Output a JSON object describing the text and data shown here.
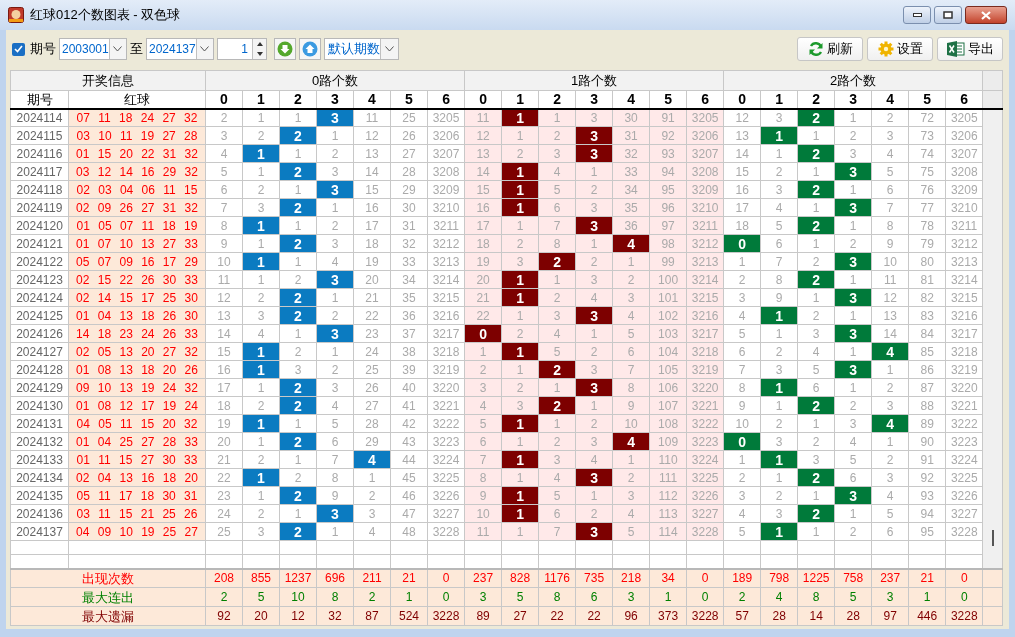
{
  "window": {
    "title": "红球012个数图表 - 双色球"
  },
  "toolbar": {
    "period_filter": {
      "label": "期号",
      "checked": true
    },
    "from": "2003001",
    "to_label": "至",
    "to": "2024137",
    "step": "1",
    "preset": "默认期数",
    "buttons": [
      {
        "label": "刷新",
        "kind": "refresh"
      },
      {
        "label": "设置",
        "kind": "settings"
      },
      {
        "label": "导出",
        "kind": "export"
      }
    ]
  },
  "table": {
    "info_header": "开奖信息",
    "columns": [
      "期号",
      "红球"
    ],
    "groups": [
      {
        "title": "0路个数",
        "color": "#0b7bc1",
        "columns": [
          "0",
          "1",
          "2",
          "3",
          "4",
          "5",
          "6"
        ]
      },
      {
        "title": "1路个数",
        "color": "#7d0000",
        "columns": [
          "0",
          "1",
          "2",
          "3",
          "4",
          "5",
          "6"
        ]
      },
      {
        "title": "2路个数",
        "color": "#007a3a",
        "columns": [
          "0",
          "1",
          "2",
          "3",
          "4",
          "5",
          "6"
        ]
      }
    ],
    "rows": [
      {
        "period": "2024114",
        "balls": "07 11 18 24 27 32",
        "groups": [
          {
            "cells": [
              "2",
              "1",
              "1",
              "3",
              "11",
              "25",
              "3205"
            ],
            "hit": [
              false,
              false,
              false,
              true,
              false,
              false,
              false
            ]
          },
          {
            "cells": [
              "11",
              "1",
              "1",
              "3",
              "30",
              "91",
              "3205"
            ],
            "hit": [
              false,
              true,
              false,
              false,
              false,
              false,
              false
            ]
          },
          {
            "cells": [
              "12",
              "3",
              "2",
              "1",
              "2",
              "72",
              "3205"
            ],
            "hit": [
              false,
              false,
              true,
              false,
              false,
              false,
              false
            ]
          }
        ]
      },
      {
        "period": "2024115",
        "balls": "03 10 11 19 27 28",
        "groups": [
          {
            "cells": [
              "3",
              "2",
              "2",
              "1",
              "12",
              "26",
              "3206"
            ],
            "hit": [
              false,
              false,
              true,
              false,
              false,
              false,
              false
            ]
          },
          {
            "cells": [
              "12",
              "1",
              "2",
              "3",
              "31",
              "92",
              "3206"
            ],
            "hit": [
              false,
              false,
              false,
              true,
              false,
              false,
              false
            ]
          },
          {
            "cells": [
              "13",
              "1",
              "1",
              "2",
              "3",
              "73",
              "3206"
            ],
            "hit": [
              false,
              true,
              false,
              false,
              false,
              false,
              false
            ]
          }
        ]
      },
      {
        "period": "2024116",
        "balls": "01 15 20 22 31 32",
        "groups": [
          {
            "cells": [
              "4",
              "1",
              "1",
              "2",
              "13",
              "27",
              "3207"
            ],
            "hit": [
              false,
              true,
              false,
              false,
              false,
              false,
              false
            ]
          },
          {
            "cells": [
              "13",
              "2",
              "3",
              "3",
              "32",
              "93",
              "3207"
            ],
            "hit": [
              false,
              false,
              false,
              true,
              false,
              false,
              false
            ]
          },
          {
            "cells": [
              "14",
              "1",
              "2",
              "3",
              "4",
              "74",
              "3207"
            ],
            "hit": [
              false,
              false,
              true,
              false,
              false,
              false,
              false
            ]
          }
        ]
      },
      {
        "period": "2024117",
        "balls": "03 12 14 16 29 32",
        "groups": [
          {
            "cells": [
              "5",
              "1",
              "2",
              "3",
              "14",
              "28",
              "3208"
            ],
            "hit": [
              false,
              false,
              true,
              false,
              false,
              false,
              false
            ]
          },
          {
            "cells": [
              "14",
              "1",
              "4",
              "1",
              "33",
              "94",
              "3208"
            ],
            "hit": [
              false,
              true,
              false,
              false,
              false,
              false,
              false
            ]
          },
          {
            "cells": [
              "15",
              "2",
              "1",
              "3",
              "5",
              "75",
              "3208"
            ],
            "hit": [
              false,
              false,
              false,
              true,
              false,
              false,
              false
            ]
          }
        ]
      },
      {
        "period": "2024118",
        "balls": "02 03 04 06 11 15",
        "groups": [
          {
            "cells": [
              "6",
              "2",
              "1",
              "3",
              "15",
              "29",
              "3209"
            ],
            "hit": [
              false,
              false,
              false,
              true,
              false,
              false,
              false
            ]
          },
          {
            "cells": [
              "15",
              "1",
              "5",
              "2",
              "34",
              "95",
              "3209"
            ],
            "hit": [
              false,
              true,
              false,
              false,
              false,
              false,
              false
            ]
          },
          {
            "cells": [
              "16",
              "3",
              "2",
              "1",
              "6",
              "76",
              "3209"
            ],
            "hit": [
              false,
              false,
              true,
              false,
              false,
              false,
              false
            ]
          }
        ]
      },
      {
        "period": "2024119",
        "balls": "02 09 26 27 31 32",
        "groups": [
          {
            "cells": [
              "7",
              "3",
              "2",
              "1",
              "16",
              "30",
              "3210"
            ],
            "hit": [
              false,
              false,
              true,
              false,
              false,
              false,
              false
            ]
          },
          {
            "cells": [
              "16",
              "1",
              "6",
              "3",
              "35",
              "96",
              "3210"
            ],
            "hit": [
              false,
              true,
              false,
              false,
              false,
              false,
              false
            ]
          },
          {
            "cells": [
              "17",
              "4",
              "1",
              "3",
              "7",
              "77",
              "3210"
            ],
            "hit": [
              false,
              false,
              false,
              true,
              false,
              false,
              false
            ]
          }
        ]
      },
      {
        "period": "2024120",
        "balls": "01 05 07 11 18 19",
        "groups": [
          {
            "cells": [
              "8",
              "1",
              "1",
              "2",
              "17",
              "31",
              "3211"
            ],
            "hit": [
              false,
              true,
              false,
              false,
              false,
              false,
              false
            ]
          },
          {
            "cells": [
              "17",
              "1",
              "7",
              "3",
              "36",
              "97",
              "3211"
            ],
            "hit": [
              false,
              false,
              false,
              true,
              false,
              false,
              false
            ]
          },
          {
            "cells": [
              "18",
              "5",
              "2",
              "1",
              "8",
              "78",
              "3211"
            ],
            "hit": [
              false,
              false,
              true,
              false,
              false,
              false,
              false
            ]
          }
        ]
      },
      {
        "period": "2024121",
        "balls": "01 07 10 13 27 33",
        "groups": [
          {
            "cells": [
              "9",
              "1",
              "2",
              "3",
              "18",
              "32",
              "3212"
            ],
            "hit": [
              false,
              false,
              true,
              false,
              false,
              false,
              false
            ]
          },
          {
            "cells": [
              "18",
              "2",
              "8",
              "1",
              "4",
              "98",
              "3212"
            ],
            "hit": [
              false,
              false,
              false,
              false,
              true,
              false,
              false
            ]
          },
          {
            "cells": [
              "0",
              "6",
              "1",
              "2",
              "9",
              "79",
              "3212"
            ],
            "hit": [
              true,
              false,
              false,
              false,
              false,
              false,
              false
            ]
          }
        ]
      },
      {
        "period": "2024122",
        "balls": "05 07 09 16 17 29",
        "groups": [
          {
            "cells": [
              "10",
              "1",
              "1",
              "4",
              "19",
              "33",
              "3213"
            ],
            "hit": [
              false,
              true,
              false,
              false,
              false,
              false,
              false
            ]
          },
          {
            "cells": [
              "19",
              "3",
              "2",
              "2",
              "1",
              "99",
              "3213"
            ],
            "hit": [
              false,
              false,
              true,
              false,
              false,
              false,
              false
            ]
          },
          {
            "cells": [
              "1",
              "7",
              "2",
              "3",
              "10",
              "80",
              "3213"
            ],
            "hit": [
              false,
              false,
              false,
              true,
              false,
              false,
              false
            ]
          }
        ]
      },
      {
        "period": "2024123",
        "balls": "02 15 22 26 30 33",
        "groups": [
          {
            "cells": [
              "11",
              "1",
              "2",
              "3",
              "20",
              "34",
              "3214"
            ],
            "hit": [
              false,
              false,
              false,
              true,
              false,
              false,
              false
            ]
          },
          {
            "cells": [
              "20",
              "1",
              "1",
              "3",
              "2",
              "100",
              "3214"
            ],
            "hit": [
              false,
              true,
              false,
              false,
              false,
              false,
              false
            ]
          },
          {
            "cells": [
              "2",
              "8",
              "2",
              "1",
              "11",
              "81",
              "3214"
            ],
            "hit": [
              false,
              false,
              true,
              false,
              false,
              false,
              false
            ]
          }
        ]
      },
      {
        "period": "2024124",
        "balls": "02 14 15 17 25 30",
        "groups": [
          {
            "cells": [
              "12",
              "2",
              "2",
              "1",
              "21",
              "35",
              "3215"
            ],
            "hit": [
              false,
              false,
              true,
              false,
              false,
              false,
              false
            ]
          },
          {
            "cells": [
              "21",
              "1",
              "2",
              "4",
              "3",
              "101",
              "3215"
            ],
            "hit": [
              false,
              true,
              false,
              false,
              false,
              false,
              false
            ]
          },
          {
            "cells": [
              "3",
              "9",
              "1",
              "3",
              "12",
              "82",
              "3215"
            ],
            "hit": [
              false,
              false,
              false,
              true,
              false,
              false,
              false
            ]
          }
        ]
      },
      {
        "period": "2024125",
        "balls": "01 04 13 18 26 30",
        "groups": [
          {
            "cells": [
              "13",
              "3",
              "2",
              "2",
              "22",
              "36",
              "3216"
            ],
            "hit": [
              false,
              false,
              true,
              false,
              false,
              false,
              false
            ]
          },
          {
            "cells": [
              "22",
              "1",
              "3",
              "3",
              "4",
              "102",
              "3216"
            ],
            "hit": [
              false,
              false,
              false,
              true,
              false,
              false,
              false
            ]
          },
          {
            "cells": [
              "4",
              "1",
              "2",
              "1",
              "13",
              "83",
              "3216"
            ],
            "hit": [
              false,
              true,
              false,
              false,
              false,
              false,
              false
            ]
          }
        ]
      },
      {
        "period": "2024126",
        "balls": "14 18 23 24 26 33",
        "groups": [
          {
            "cells": [
              "14",
              "4",
              "1",
              "3",
              "23",
              "37",
              "3217"
            ],
            "hit": [
              false,
              false,
              false,
              true,
              false,
              false,
              false
            ]
          },
          {
            "cells": [
              "0",
              "2",
              "4",
              "1",
              "5",
              "103",
              "3217"
            ],
            "hit": [
              true,
              false,
              false,
              false,
              false,
              false,
              false
            ]
          },
          {
            "cells": [
              "5",
              "1",
              "3",
              "3",
              "14",
              "84",
              "3217"
            ],
            "hit": [
              false,
              false,
              false,
              true,
              false,
              false,
              false
            ]
          }
        ]
      },
      {
        "period": "2024127",
        "balls": "02 05 13 20 27 32",
        "groups": [
          {
            "cells": [
              "15",
              "1",
              "2",
              "1",
              "24",
              "38",
              "3218"
            ],
            "hit": [
              false,
              true,
              false,
              false,
              false,
              false,
              false
            ]
          },
          {
            "cells": [
              "1",
              "1",
              "5",
              "2",
              "6",
              "104",
              "3218"
            ],
            "hit": [
              false,
              true,
              false,
              false,
              false,
              false,
              false
            ]
          },
          {
            "cells": [
              "6",
              "2",
              "4",
              "1",
              "4",
              "85",
              "3218"
            ],
            "hit": [
              false,
              false,
              false,
              false,
              true,
              false,
              false
            ]
          }
        ]
      },
      {
        "period": "2024128",
        "balls": "01 08 13 18 20 26",
        "groups": [
          {
            "cells": [
              "16",
              "1",
              "3",
              "2",
              "25",
              "39",
              "3219"
            ],
            "hit": [
              false,
              true,
              false,
              false,
              false,
              false,
              false
            ]
          },
          {
            "cells": [
              "2",
              "1",
              "2",
              "3",
              "7",
              "105",
              "3219"
            ],
            "hit": [
              false,
              false,
              true,
              false,
              false,
              false,
              false
            ]
          },
          {
            "cells": [
              "7",
              "3",
              "5",
              "3",
              "1",
              "86",
              "3219"
            ],
            "hit": [
              false,
              false,
              false,
              true,
              false,
              false,
              false
            ]
          }
        ]
      },
      {
        "period": "2024129",
        "balls": "09 10 13 19 24 32",
        "groups": [
          {
            "cells": [
              "17",
              "1",
              "2",
              "3",
              "26",
              "40",
              "3220"
            ],
            "hit": [
              false,
              false,
              true,
              false,
              false,
              false,
              false
            ]
          },
          {
            "cells": [
              "3",
              "2",
              "1",
              "3",
              "8",
              "106",
              "3220"
            ],
            "hit": [
              false,
              false,
              false,
              true,
              false,
              false,
              false
            ]
          },
          {
            "cells": [
              "8",
              "1",
              "6",
              "1",
              "2",
              "87",
              "3220"
            ],
            "hit": [
              false,
              true,
              false,
              false,
              false,
              false,
              false
            ]
          }
        ]
      },
      {
        "period": "2024130",
        "balls": "01 08 12 17 19 24",
        "groups": [
          {
            "cells": [
              "18",
              "2",
              "2",
              "4",
              "27",
              "41",
              "3221"
            ],
            "hit": [
              false,
              false,
              true,
              false,
              false,
              false,
              false
            ]
          },
          {
            "cells": [
              "4",
              "3",
              "2",
              "1",
              "9",
              "107",
              "3221"
            ],
            "hit": [
              false,
              false,
              true,
              false,
              false,
              false,
              false
            ]
          },
          {
            "cells": [
              "9",
              "1",
              "2",
              "2",
              "3",
              "88",
              "3221"
            ],
            "hit": [
              false,
              false,
              true,
              false,
              false,
              false,
              false
            ]
          }
        ]
      },
      {
        "period": "2024131",
        "balls": "04 05 11 15 20 32",
        "groups": [
          {
            "cells": [
              "19",
              "1",
              "1",
              "5",
              "28",
              "42",
              "3222"
            ],
            "hit": [
              false,
              true,
              false,
              false,
              false,
              false,
              false
            ]
          },
          {
            "cells": [
              "5",
              "1",
              "1",
              "2",
              "10",
              "108",
              "3222"
            ],
            "hit": [
              false,
              true,
              false,
              false,
              false,
              false,
              false
            ]
          },
          {
            "cells": [
              "10",
              "2",
              "1",
              "3",
              "4",
              "89",
              "3222"
            ],
            "hit": [
              false,
              false,
              false,
              false,
              true,
              false,
              false
            ]
          }
        ]
      },
      {
        "period": "2024132",
        "balls": "01 04 25 27 28 33",
        "groups": [
          {
            "cells": [
              "20",
              "1",
              "2",
              "6",
              "29",
              "43",
              "3223"
            ],
            "hit": [
              false,
              false,
              true,
              false,
              false,
              false,
              false
            ]
          },
          {
            "cells": [
              "6",
              "1",
              "2",
              "3",
              "4",
              "109",
              "3223"
            ],
            "hit": [
              false,
              false,
              false,
              false,
              true,
              false,
              false
            ]
          },
          {
            "cells": [
              "0",
              "3",
              "2",
              "4",
              "1",
              "90",
              "3223"
            ],
            "hit": [
              true,
              false,
              false,
              false,
              false,
              false,
              false
            ]
          }
        ]
      },
      {
        "period": "2024133",
        "balls": "01 11 15 27 30 33",
        "groups": [
          {
            "cells": [
              "21",
              "2",
              "1",
              "7",
              "4",
              "44",
              "3224"
            ],
            "hit": [
              false,
              false,
              false,
              false,
              true,
              false,
              false
            ]
          },
          {
            "cells": [
              "7",
              "1",
              "3",
              "4",
              "1",
              "110",
              "3224"
            ],
            "hit": [
              false,
              true,
              false,
              false,
              false,
              false,
              false
            ]
          },
          {
            "cells": [
              "1",
              "1",
              "3",
              "5",
              "2",
              "91",
              "3224"
            ],
            "hit": [
              false,
              true,
              false,
              false,
              false,
              false,
              false
            ]
          }
        ]
      },
      {
        "period": "2024134",
        "balls": "02 04 13 16 18 20",
        "groups": [
          {
            "cells": [
              "22",
              "1",
              "2",
              "8",
              "1",
              "45",
              "3225"
            ],
            "hit": [
              false,
              true,
              false,
              false,
              false,
              false,
              false
            ]
          },
          {
            "cells": [
              "8",
              "1",
              "4",
              "3",
              "2",
              "111",
              "3225"
            ],
            "hit": [
              false,
              false,
              false,
              true,
              false,
              false,
              false
            ]
          },
          {
            "cells": [
              "2",
              "1",
              "2",
              "6",
              "3",
              "92",
              "3225"
            ],
            "hit": [
              false,
              false,
              true,
              false,
              false,
              false,
              false
            ]
          }
        ]
      },
      {
        "period": "2024135",
        "balls": "05 11 17 18 30 31",
        "groups": [
          {
            "cells": [
              "23",
              "1",
              "2",
              "9",
              "2",
              "46",
              "3226"
            ],
            "hit": [
              false,
              false,
              true,
              false,
              false,
              false,
              false
            ]
          },
          {
            "cells": [
              "9",
              "1",
              "5",
              "1",
              "3",
              "112",
              "3226"
            ],
            "hit": [
              false,
              true,
              false,
              false,
              false,
              false,
              false
            ]
          },
          {
            "cells": [
              "3",
              "2",
              "1",
              "3",
              "4",
              "93",
              "3226"
            ],
            "hit": [
              false,
              false,
              false,
              true,
              false,
              false,
              false
            ]
          }
        ]
      },
      {
        "period": "2024136",
        "balls": "03 11 15 21 25 26",
        "groups": [
          {
            "cells": [
              "24",
              "2",
              "1",
              "3",
              "3",
              "47",
              "3227"
            ],
            "hit": [
              false,
              false,
              false,
              true,
              false,
              false,
              false
            ]
          },
          {
            "cells": [
              "10",
              "1",
              "6",
              "2",
              "4",
              "113",
              "3227"
            ],
            "hit": [
              false,
              true,
              false,
              false,
              false,
              false,
              false
            ]
          },
          {
            "cells": [
              "4",
              "3",
              "2",
              "1",
              "5",
              "94",
              "3227"
            ],
            "hit": [
              false,
              false,
              true,
              false,
              false,
              false,
              false
            ]
          }
        ]
      },
      {
        "period": "2024137",
        "balls": "04 09 10 19 25 27",
        "groups": [
          {
            "cells": [
              "25",
              "3",
              "2",
              "1",
              "4",
              "48",
              "3228"
            ],
            "hit": [
              false,
              false,
              true,
              false,
              false,
              false,
              false
            ]
          },
          {
            "cells": [
              "11",
              "1",
              "7",
              "3",
              "5",
              "114",
              "3228"
            ],
            "hit": [
              false,
              false,
              false,
              true,
              false,
              false,
              false
            ]
          },
          {
            "cells": [
              "5",
              "1",
              "1",
              "2",
              "6",
              "95",
              "3228"
            ],
            "hit": [
              false,
              true,
              false,
              false,
              false,
              false,
              false
            ]
          }
        ]
      }
    ],
    "stats": [
      {
        "label": "出现次数",
        "kind": "count",
        "values": [
          "208",
          "855",
          "1237",
          "696",
          "211",
          "21",
          "0",
          "237",
          "828",
          "1176",
          "735",
          "218",
          "34",
          "0",
          "189",
          "798",
          "1225",
          "758",
          "237",
          "21",
          "0"
        ]
      },
      {
        "label": "最大连出",
        "kind": "streak",
        "values": [
          "2",
          "5",
          "10",
          "8",
          "2",
          "1",
          "0",
          "3",
          "5",
          "8",
          "6",
          "3",
          "1",
          "0",
          "2",
          "4",
          "8",
          "5",
          "3",
          "1",
          "0"
        ]
      },
      {
        "label": "最大遗漏",
        "kind": "omission",
        "values": [
          "92",
          "20",
          "12",
          "32",
          "87",
          "524",
          "3228",
          "89",
          "27",
          "22",
          "22",
          "96",
          "373",
          "3228",
          "57",
          "28",
          "14",
          "28",
          "97",
          "446",
          "3228"
        ]
      }
    ]
  }
}
